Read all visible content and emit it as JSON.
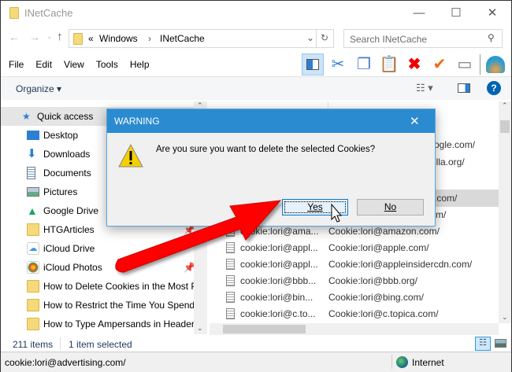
{
  "window": {
    "title": "INetCache",
    "minimize": "—",
    "maximize": "☐",
    "close": "✕"
  },
  "address": {
    "breadcrumb_prefix": "«",
    "segments": [
      "Windows",
      "INetCache"
    ],
    "separator": "›",
    "search_placeholder": "Search INetCache"
  },
  "menu": [
    "File",
    "Edit",
    "View",
    "Tools",
    "Help"
  ],
  "toolbar": {
    "organize": "Organize ▾",
    "help": "?"
  },
  "nav": {
    "items": [
      {
        "label": "Quick access",
        "icon": "star-icon"
      },
      {
        "label": "Desktop",
        "icon": "desktop-icon"
      },
      {
        "label": "Downloads",
        "icon": "download-icon"
      },
      {
        "label": "Documents",
        "icon": "document-icon"
      },
      {
        "label": "Pictures",
        "icon": "pictures-icon"
      },
      {
        "label": "Google Drive",
        "icon": "google-drive-icon"
      },
      {
        "label": "HTGArticles",
        "icon": "folder-icon"
      },
      {
        "label": "iCloud Drive",
        "icon": "icloud-icon"
      },
      {
        "label": "iCloud Photos",
        "icon": "photos-icon"
      },
      {
        "label": "How to Delete Cookies in the Most P",
        "icon": "folder-icon"
      },
      {
        "label": "How to Restrict the Time You Spend",
        "icon": "folder-icon"
      },
      {
        "label": "How to Type Ampersands in Header",
        "icon": "folder-icon"
      }
    ]
  },
  "list": {
    "partial": [
      "ogle.com/",
      "illa.org/",
      ".com/",
      "m/"
    ],
    "rows": [
      {
        "name": "cookie:lori@ama...",
        "address": "Cookie:lori@amazon.com/"
      },
      {
        "name": "cookie:lori@appl...",
        "address": "Cookie:lori@apple.com/"
      },
      {
        "name": "cookie:lori@appl...",
        "address": "Cookie:lori@appleinsidercdn.com/"
      },
      {
        "name": "cookie:lori@bbb...",
        "address": "Cookie:lori@bbb.org/"
      },
      {
        "name": "cookie:lori@bin...",
        "address": "Cookie:lori@bing.com/"
      },
      {
        "name": "cookie:lori@c.to...",
        "address": "Cookie:lori@c.topica.com/"
      }
    ]
  },
  "status": {
    "items": "211 items",
    "selected": "1 item selected",
    "selected_item": "cookie:lori@advertising.com/",
    "zone": "Internet"
  },
  "dialog": {
    "title": "WARNING",
    "message": "Are you sure you want to delete the selected Cookies?",
    "yes": "Yes",
    "no": "No",
    "close": "✕"
  }
}
